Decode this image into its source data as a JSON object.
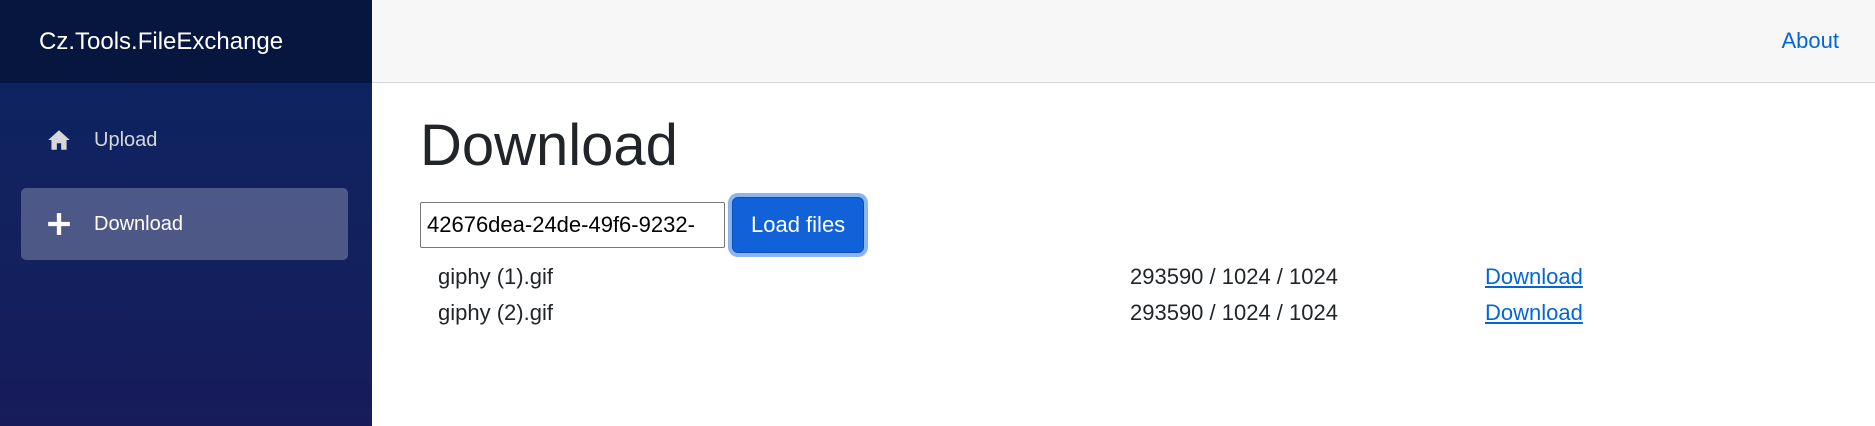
{
  "app": {
    "brand": "Cz.Tools.FileExchange"
  },
  "sidebar": {
    "items": [
      {
        "label": "Upload",
        "icon": "home-icon",
        "active": false
      },
      {
        "label": "Download",
        "icon": "plus-icon",
        "active": true
      }
    ]
  },
  "topbar": {
    "about_label": "About"
  },
  "page": {
    "title": "Download",
    "key_input_value": "42676dea-24de-49f6-9232-",
    "load_button_label": "Load files"
  },
  "files": [
    {
      "name": "giphy (1).gif",
      "size": "293590 / 1024 / 1024",
      "link_label": "Download"
    },
    {
      "name": "giphy (2).gif",
      "size": "293590 / 1024 / 1024",
      "link_label": "Download"
    }
  ],
  "colors": {
    "sidebar_top": "#06163e",
    "sidebar_gradient_start": "#0b2462",
    "sidebar_gradient_end": "#171b5a",
    "accent": "#1161d8",
    "link": "#0366d6"
  }
}
